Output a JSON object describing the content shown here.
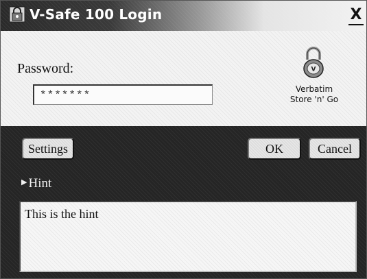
{
  "window": {
    "title": "V-Safe 100 Login",
    "close_label": "X"
  },
  "login": {
    "password_label": "Password:",
    "password_value": "*******"
  },
  "brand": {
    "line1": "Verbatim",
    "line2": "Store 'n' Go",
    "icon": "padlock-icon"
  },
  "buttons": {
    "settings": "Settings",
    "ok": "OK",
    "cancel": "Cancel"
  },
  "hint": {
    "toggle_label": "Hint",
    "text": "This is the hint"
  }
}
